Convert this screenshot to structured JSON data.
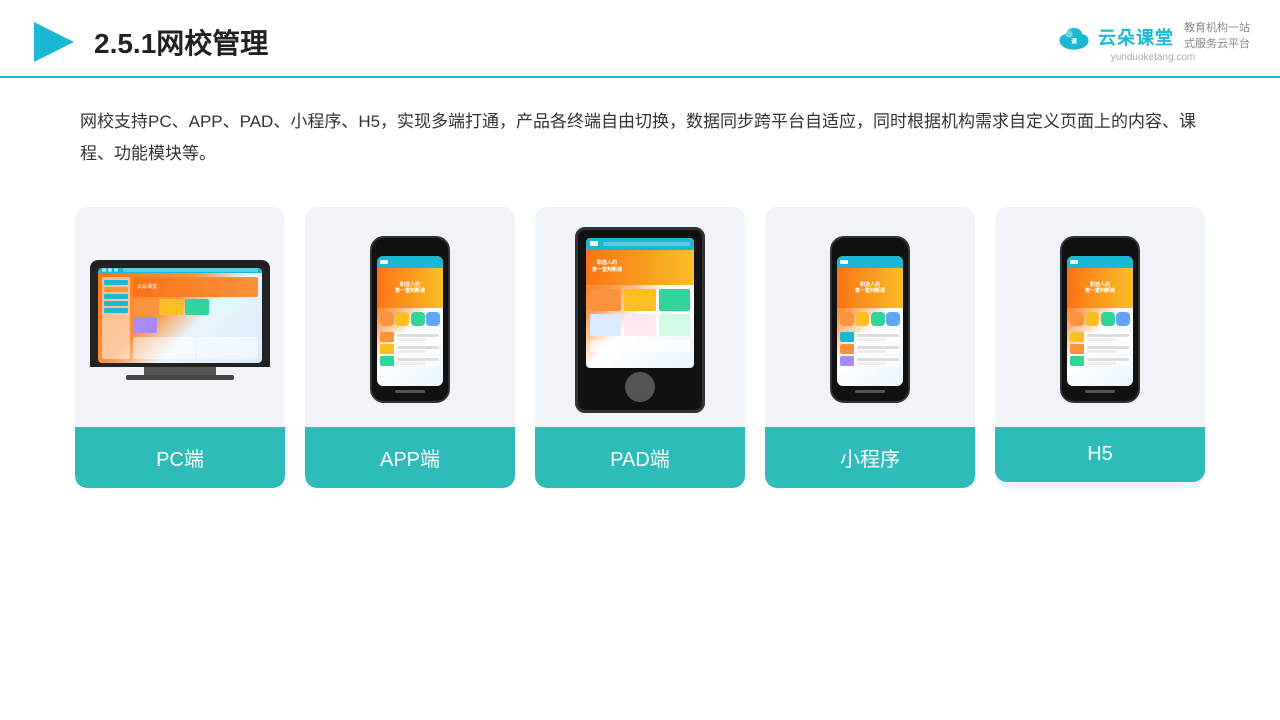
{
  "header": {
    "title": "2.5.1网校管理",
    "logo_text": "云朵课堂",
    "logo_tagline": "教育机构一站\n式服务云平台",
    "logo_url": "yunduoketang.com"
  },
  "description": "网校支持PC、APP、PAD、小程序、H5，实现多端打通，产品各终端自由切换，数据同步跨平台自适应，同时根据机构需求自定义页面上的内容、课程、功能模块等。",
  "cards": [
    {
      "id": "pc",
      "label": "PC端"
    },
    {
      "id": "app",
      "label": "APP端"
    },
    {
      "id": "pad",
      "label": "PAD端"
    },
    {
      "id": "miniapp",
      "label": "小程序"
    },
    {
      "id": "h5",
      "label": "H5"
    }
  ],
  "accent_color": "#2dbcb8",
  "header_line_color": "#1bb8d4"
}
